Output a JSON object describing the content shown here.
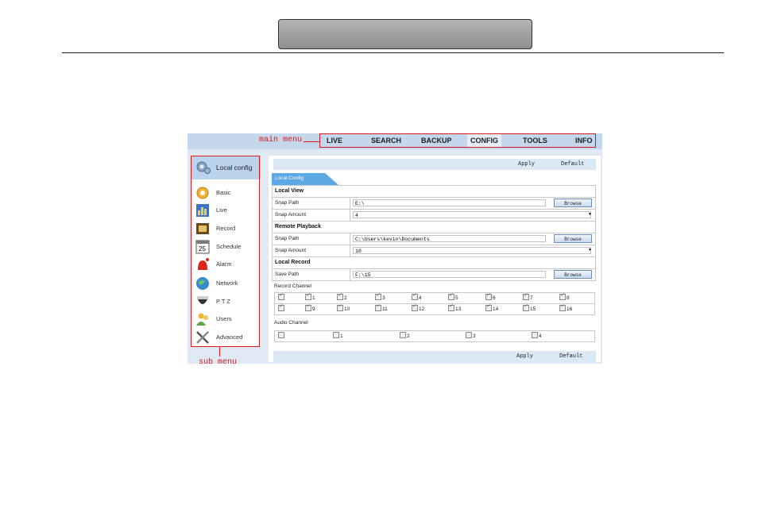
{
  "annotations": {
    "main_menu": "main menu",
    "sub_menu": "sub menu"
  },
  "main_menu": [
    "LIVE",
    "SEARCH",
    "BACKUP",
    "CONFIG",
    "TOOLS",
    "INFO"
  ],
  "active_main": "CONFIG",
  "sub_menu": {
    "header": {
      "label": "Local config",
      "icon": "gear-icon"
    },
    "items": [
      {
        "label": "Basic",
        "icon": "gear-icon"
      },
      {
        "label": "Live",
        "icon": "live-chart-icon"
      },
      {
        "label": "Record",
        "icon": "film-icon"
      },
      {
        "label": "Schedule",
        "icon": "calendar-icon"
      },
      {
        "label": "Alarm",
        "icon": "alarm-icon"
      },
      {
        "label": "Network",
        "icon": "globe-icon"
      },
      {
        "label": "P T Z",
        "icon": "dome-camera-icon"
      },
      {
        "label": "Users",
        "icon": "users-icon"
      },
      {
        "label": "Advanced",
        "icon": "tools-icon"
      }
    ]
  },
  "buttons": {
    "apply": "Apply",
    "default": "Default",
    "browse": "Browse"
  },
  "tab": "Local Config",
  "local_view": {
    "title": "Local View",
    "snap_path_label": "Snap Path",
    "snap_path": "E:\\",
    "snap_amount_label": "Snap Amount",
    "snap_amount": "4"
  },
  "remote_playback": {
    "title": "Remote Playback",
    "snap_path_label": "Snap Path",
    "snap_path": "C:\\Users\\kevin\\Documents",
    "snap_amount_label": "Snap Amount",
    "snap_amount": "10"
  },
  "local_record": {
    "title": "Local Record",
    "save_path_label": "Save Path",
    "save_path": "F:\\15"
  },
  "record_channel": {
    "title": "Record Channel",
    "rows": [
      [
        "",
        "1",
        "2",
        "3",
        "4",
        "5",
        "6",
        "7",
        "8"
      ],
      [
        "",
        "9",
        "10",
        "11",
        "12",
        "13",
        "14",
        "15",
        "16"
      ]
    ]
  },
  "audio_channel": {
    "title": "Audio Channel",
    "items": [
      "",
      "1",
      "2",
      "3",
      "4"
    ]
  },
  "colors": {
    "annotation": "#d81a1a",
    "tab_blue": "#5ba8e4",
    "bar": "#dbe8f6"
  }
}
